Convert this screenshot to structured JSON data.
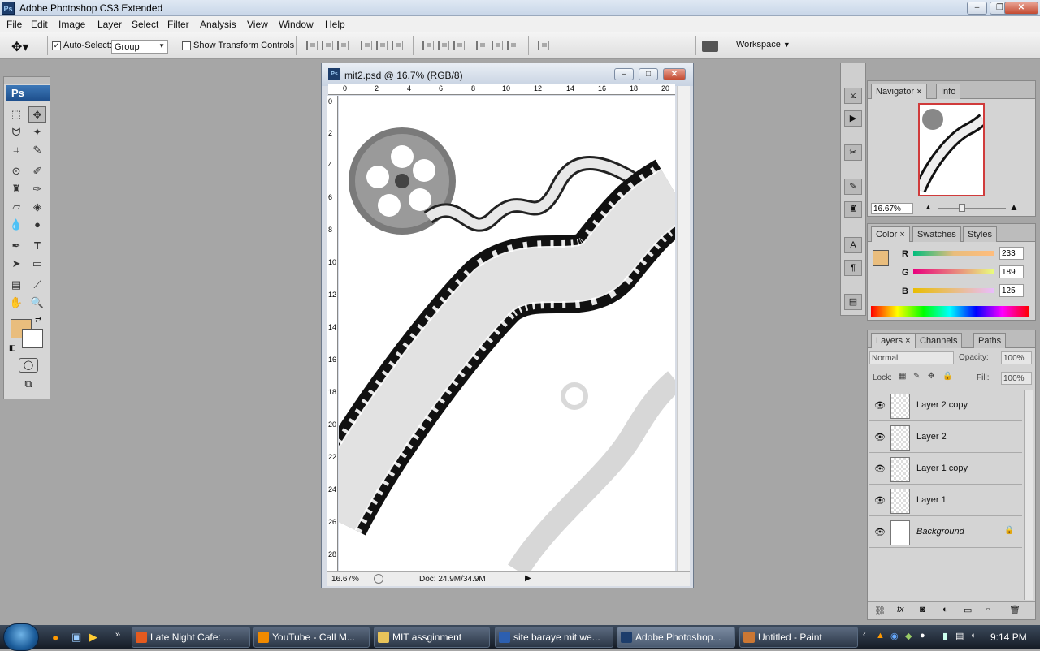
{
  "app": {
    "title": "Adobe Photoshop CS3 Extended",
    "logo": "Ps"
  },
  "menu": [
    "File",
    "Edit",
    "Image",
    "Layer",
    "Select",
    "Filter",
    "Analysis",
    "View",
    "Window",
    "Help"
  ],
  "options": {
    "auto_select_label": "Auto-Select:",
    "auto_select_value": "Group",
    "transform_label": "Show Transform Controls",
    "workspace_label": "Workspace"
  },
  "document": {
    "title": "mit2.psd @ 16.7% (RGB/8)",
    "zoom": "16.67%",
    "doc_info": "Doc: 24.9M/34.9M",
    "ruler_h": [
      "0",
      "2",
      "4",
      "6",
      "8",
      "10",
      "12",
      "14",
      "16",
      "18",
      "20"
    ],
    "ruler_v": [
      "0",
      "2",
      "4",
      "6",
      "8",
      "10",
      "12",
      "14",
      "16",
      "18",
      "20",
      "22",
      "24",
      "26",
      "28"
    ]
  },
  "navigator": {
    "tabs": [
      "Navigator",
      "Info"
    ],
    "zoom": "16.67%"
  },
  "color": {
    "tabs": [
      "Color",
      "Swatches",
      "Styles"
    ],
    "r_label": "R",
    "g_label": "G",
    "b_label": "B",
    "r": "233",
    "g": "189",
    "b": "125",
    "foreground": "#e9bd7d",
    "background": "#ffffff"
  },
  "layers": {
    "tabs": [
      "Layers",
      "Channels",
      "Paths"
    ],
    "blend_mode": "Normal",
    "opacity_label": "Opacity:",
    "opacity": "100%",
    "lock_label": "Lock:",
    "fill_label": "Fill:",
    "fill": "100%",
    "items": [
      {
        "name": "Layer 2 copy"
      },
      {
        "name": "Layer 2"
      },
      {
        "name": "Layer 1 copy"
      },
      {
        "name": "Layer 1"
      },
      {
        "name": "Background"
      }
    ]
  },
  "toolbox": {
    "logo": "Ps"
  },
  "taskbar": {
    "items": [
      "Late Night Cafe: ...",
      "YouTube - Call M...",
      "MIT  assginment",
      "site baraye mit we...",
      "Adobe Photoshop...",
      "Untitled - Paint"
    ],
    "clock": "9:14 PM"
  }
}
